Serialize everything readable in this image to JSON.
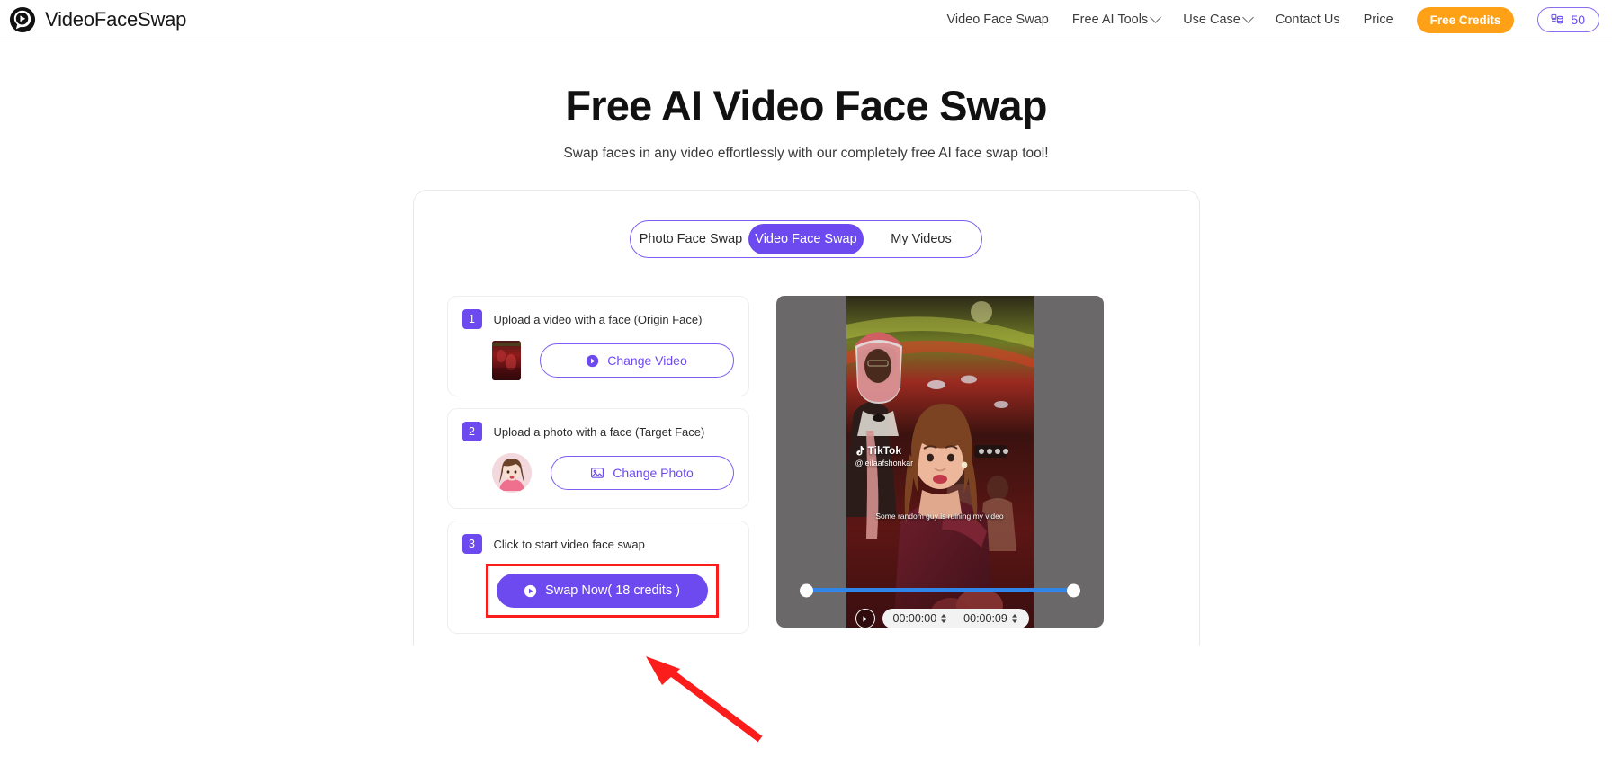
{
  "header": {
    "brand_name": "VideoFaceSwap",
    "logo_icon": "videofaceswap-logo-icon",
    "nav": [
      {
        "label": "Video Face Swap",
        "has_chevron": false
      },
      {
        "label": "Free AI Tools",
        "has_chevron": true
      },
      {
        "label": "Use Case",
        "has_chevron": true
      },
      {
        "label": "Contact Us",
        "has_chevron": false
      },
      {
        "label": "Price",
        "has_chevron": false
      }
    ],
    "free_credits_label": "Free Credits",
    "free_credits_color": "#ffa116",
    "credit_count": "50",
    "credit_icon": "coin-stack-icon"
  },
  "hero": {
    "title": "Free AI Video Face Swap",
    "subtitle": "Swap faces in any video effortlessly with our completely free AI face swap tool!"
  },
  "tabs": {
    "items": [
      {
        "label": "Photo Face Swap",
        "active": false
      },
      {
        "label": "Video Face Swap",
        "active": true
      },
      {
        "label": "My Videos",
        "active": false
      }
    ],
    "accent_color": "#6d4aef"
  },
  "steps": [
    {
      "number": "1",
      "label": "Upload a video with a face  (Origin Face)",
      "button_label": "Change Video",
      "button_icon": "play-circle-icon"
    },
    {
      "number": "2",
      "label": "Upload a photo with a face  (Target Face)",
      "button_label": "Change Photo",
      "button_icon": "image-icon"
    },
    {
      "number": "3",
      "label": "Click to start video face swap",
      "button_label": "Swap Now( 18 credits )",
      "button_icon": "play-circle-icon",
      "highlight_color": "#fb1c1c"
    }
  ],
  "preview": {
    "watermark_brand": "TikTok",
    "watermark_handle": "@leilaafshonkar",
    "caption": "Some random guy is ruining my video",
    "start_time": "00:00:00",
    "end_time": "00:00:09",
    "play_icon": "play-circle-icon",
    "trim_bar_color": "#2f86e8"
  },
  "annotation": {
    "arrow_color": "#fb1c1c",
    "arrow_name": "red-pointer-arrow"
  }
}
